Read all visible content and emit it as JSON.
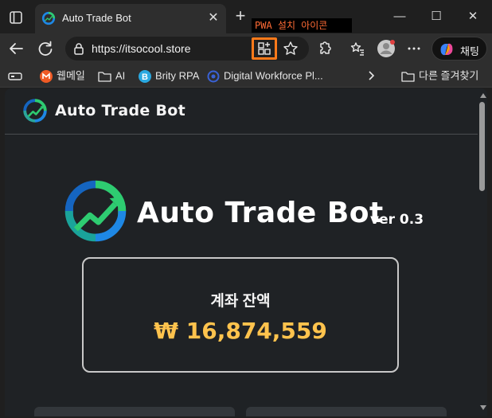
{
  "browser": {
    "tab": {
      "title": "Auto Trade Bot",
      "close_glyph": "✕"
    },
    "new_tab_glyph": "+",
    "annotation": "PWA 설치 아이콘",
    "window_controls": {
      "minimize": "—",
      "maximize": "☐",
      "close": "✕"
    },
    "address_bar": {
      "url": "https://itsocool.store"
    },
    "chat_button": {
      "label": "채팅"
    }
  },
  "bookmarks": {
    "items": [
      {
        "label": "웹메일",
        "icon": "gmail-m-icon"
      },
      {
        "label": "AI",
        "icon": "folder-icon"
      },
      {
        "label": "Brity RPA",
        "icon": "brity-b-icon"
      },
      {
        "label": "Digital Workforce Pl...",
        "icon": "globe-icon"
      }
    ],
    "other_favorites": "다른 즐겨찾기"
  },
  "site": {
    "header_title": "Auto Trade Bot",
    "hero_title": "Auto Trade Bot",
    "version": "ver 0.3",
    "balance": {
      "label": "계좌 잔액",
      "value": "₩ 16,874,559"
    }
  },
  "colors": {
    "accent_orange": "#ff7a1a",
    "balance_gold": "#ffc34d",
    "page_bg": "#1f2225",
    "logo_green": "#2ecc71",
    "logo_blue": "#1e88e5"
  }
}
